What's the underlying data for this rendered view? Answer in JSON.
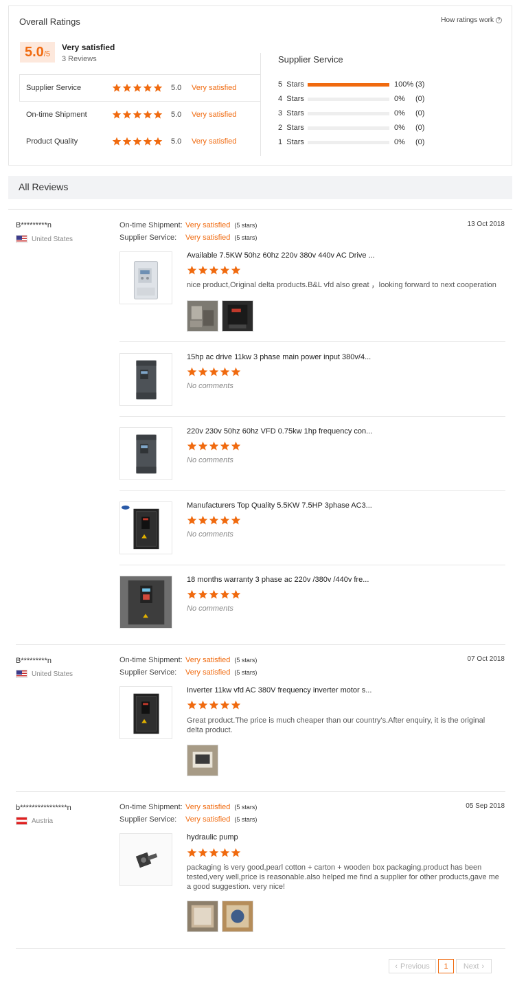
{
  "overall": {
    "title": "Overall Ratings",
    "how_link": "How ratings work",
    "score": "5.0",
    "score_max": "/5",
    "satisfaction": "Very satisfied",
    "review_count": "3 Reviews",
    "categories": [
      {
        "label": "Supplier Service",
        "score": "5.0",
        "text": "Very satisfied",
        "stars": 5
      },
      {
        "label": "On-time Shipment",
        "score": "5.0",
        "text": "Very satisfied",
        "stars": 5
      },
      {
        "label": "Product Quality",
        "score": "5.0",
        "text": "Very satisfied",
        "stars": 5
      }
    ]
  },
  "distribution": {
    "title": "Supplier Service",
    "rows": [
      {
        "label": "5  Stars",
        "percent": 100,
        "percent_text": "100%",
        "count": "(3)"
      },
      {
        "label": "4  Stars",
        "percent": 0,
        "percent_text": "0%",
        "count": "(0)"
      },
      {
        "label": "3  Stars",
        "percent": 0,
        "percent_text": "0%",
        "count": "(0)"
      },
      {
        "label": "2  Stars",
        "percent": 0,
        "percent_text": "0%",
        "count": "(0)"
      },
      {
        "label": "1  Stars",
        "percent": 0,
        "percent_text": "0%",
        "count": "(0)"
      }
    ]
  },
  "all_reviews_title": "All Reviews",
  "labels": {
    "shipment": "On-time Shipment:",
    "service": "Supplier Service:",
    "very_satisfied": "Very satisfied",
    "five_stars": "(5 stars)",
    "no_comments": "No comments"
  },
  "reviews": [
    {
      "user": "B*********n",
      "country": "United States",
      "date": "13 Oct 2018",
      "products": [
        {
          "name": "Available 7.5KW 50hz 60hz 220v 380v 440v AC Drive ...",
          "stars": 5,
          "comment": "nice product,Original delta products.B&L vfd also great ，looking forward to next cooperation"
        },
        {
          "name": "15hp ac drive 11kw 3 phase main power input 380v/4...",
          "stars": 5,
          "comment": ""
        },
        {
          "name": "220v 230v 50hz 60hz VFD 0.75kw 1hp frequency con...",
          "stars": 5,
          "comment": ""
        },
        {
          "name": "Manufacturers Top Quality 5.5KW 7.5HP 3phase AC3...",
          "stars": 5,
          "comment": ""
        },
        {
          "name": "18 months warranty 3 phase ac 220v /380v /440v fre...",
          "stars": 5,
          "comment": ""
        }
      ]
    },
    {
      "user": "B*********n",
      "country": "United States",
      "date": "07 Oct 2018",
      "products": [
        {
          "name": "Inverter 11kw vfd AC 380V frequency inverter motor s...",
          "stars": 5,
          "comment": "Great product.The price is much cheaper than our country's.After enquiry, it is the original delta product."
        }
      ]
    },
    {
      "user": "b****************n",
      "country": "Austria",
      "date": "05 Sep 2018",
      "products": [
        {
          "name": "hydraulic pump",
          "stars": 5,
          "comment": "packaging is very good,pearl cotton + carton + wooden box packaging.product has been tested,very well,price is reasonable.also helped me find a supplier for other products,gave me a good suggestion. very nice!"
        }
      ]
    }
  ],
  "pagination": {
    "previous": "Previous",
    "current": "1",
    "next": "Next"
  },
  "colors": {
    "accent": "#f06a0f",
    "score_bg": "#fde8dc",
    "header_bg": "#f2f3f5"
  }
}
